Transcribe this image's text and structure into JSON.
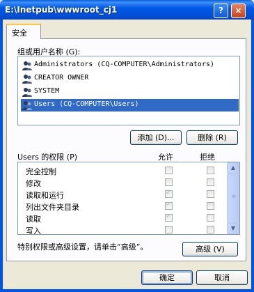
{
  "window": {
    "title": "E:\\Inetpub\\wwwroot_cj1",
    "help_button": "?",
    "close_button": "×"
  },
  "tabs": [
    {
      "label": "安全"
    }
  ],
  "users_section": {
    "label": "组或用户名称 (G):",
    "users": [
      {
        "name": "Administrators (CQ-COMPUTER\\Administrators)",
        "selected": false
      },
      {
        "name": "CREATOR OWNER",
        "selected": false
      },
      {
        "name": "SYSTEM",
        "selected": false
      },
      {
        "name": "Users (CQ-COMPUTER\\Users)",
        "selected": true
      }
    ],
    "add_button": "添加 (D)...",
    "remove_button": "删除 (R)"
  },
  "permissions_section": {
    "label": "Users 的权限 (P)",
    "allow_header": "允许",
    "deny_header": "拒绝",
    "rows": [
      {
        "name": "完全控制",
        "allow": false,
        "deny": false
      },
      {
        "name": "修改",
        "allow": false,
        "deny": false
      },
      {
        "name": "读取和运行",
        "allow": true,
        "deny": false
      },
      {
        "name": "列出文件夹目录",
        "allow": true,
        "deny": false
      },
      {
        "name": "读取",
        "allow": true,
        "deny": false
      },
      {
        "name": "写入",
        "allow": false,
        "deny": false
      }
    ]
  },
  "advanced": {
    "text": "特别权限或高级设置，请单击“高级”。",
    "button": "高级 (V)"
  },
  "footer": {
    "ok": "确定",
    "cancel": "取消"
  },
  "colors": {
    "titlebar": "#0054E3",
    "selection": "#316AC5",
    "dialog_bg": "#ECE9D8"
  }
}
